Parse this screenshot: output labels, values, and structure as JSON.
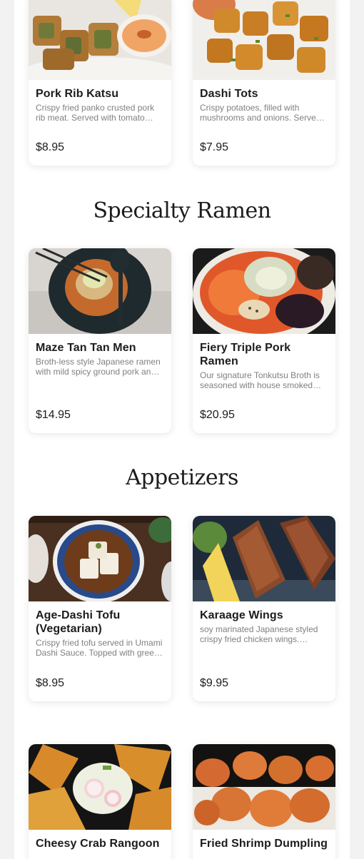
{
  "sections": [
    {
      "title": "Specialty Ramen"
    },
    {
      "title": "Appetizers"
    }
  ],
  "items": [
    {
      "name": "Pork Rib Katsu",
      "description": "Crispy fried panko crusted pork rib meat. Served with tomato mustard sauce.",
      "price": "$8.95",
      "image": "katsu-photo"
    },
    {
      "name": "Dashi Tots",
      "description": "Crispy potatoes, filled with mushrooms and onions. Served with dipping sauce.",
      "price": "$7.95",
      "image": "tots-photo"
    },
    {
      "name": "Maze Tan Tan Men",
      "description": "Broth-less style Japanese ramen with mild spicy ground pork and sesame sauce.",
      "price": "$14.95",
      "image": "tantan-photo"
    },
    {
      "name": "Fiery Triple Pork Ramen",
      "description": "Our signature Tonkutsu Broth is seasoned with house smoked chili oil and three kinds of pork.",
      "price": "$20.95",
      "image": "fiery-photo"
    },
    {
      "name": "Age-Dashi Tofu (Vegetarian)",
      "description": "Crispy fried tofu served in Umami Dashi Sauce. Topped with green onion.",
      "price": "$8.95",
      "image": "tofu-photo"
    },
    {
      "name": "Karaage Wings",
      "description": "soy marinated Japanese styled crispy fried chicken wings. Served with lemon.",
      "price": "$9.95",
      "image": "wings-photo"
    },
    {
      "name": "Cheesy Crab Rangoon",
      "description": "",
      "price": "",
      "image": "rangoon-photo"
    },
    {
      "name": "Fried Shrimp Dumpling",
      "description": "",
      "price": "",
      "image": "dumpling-photo"
    }
  ]
}
